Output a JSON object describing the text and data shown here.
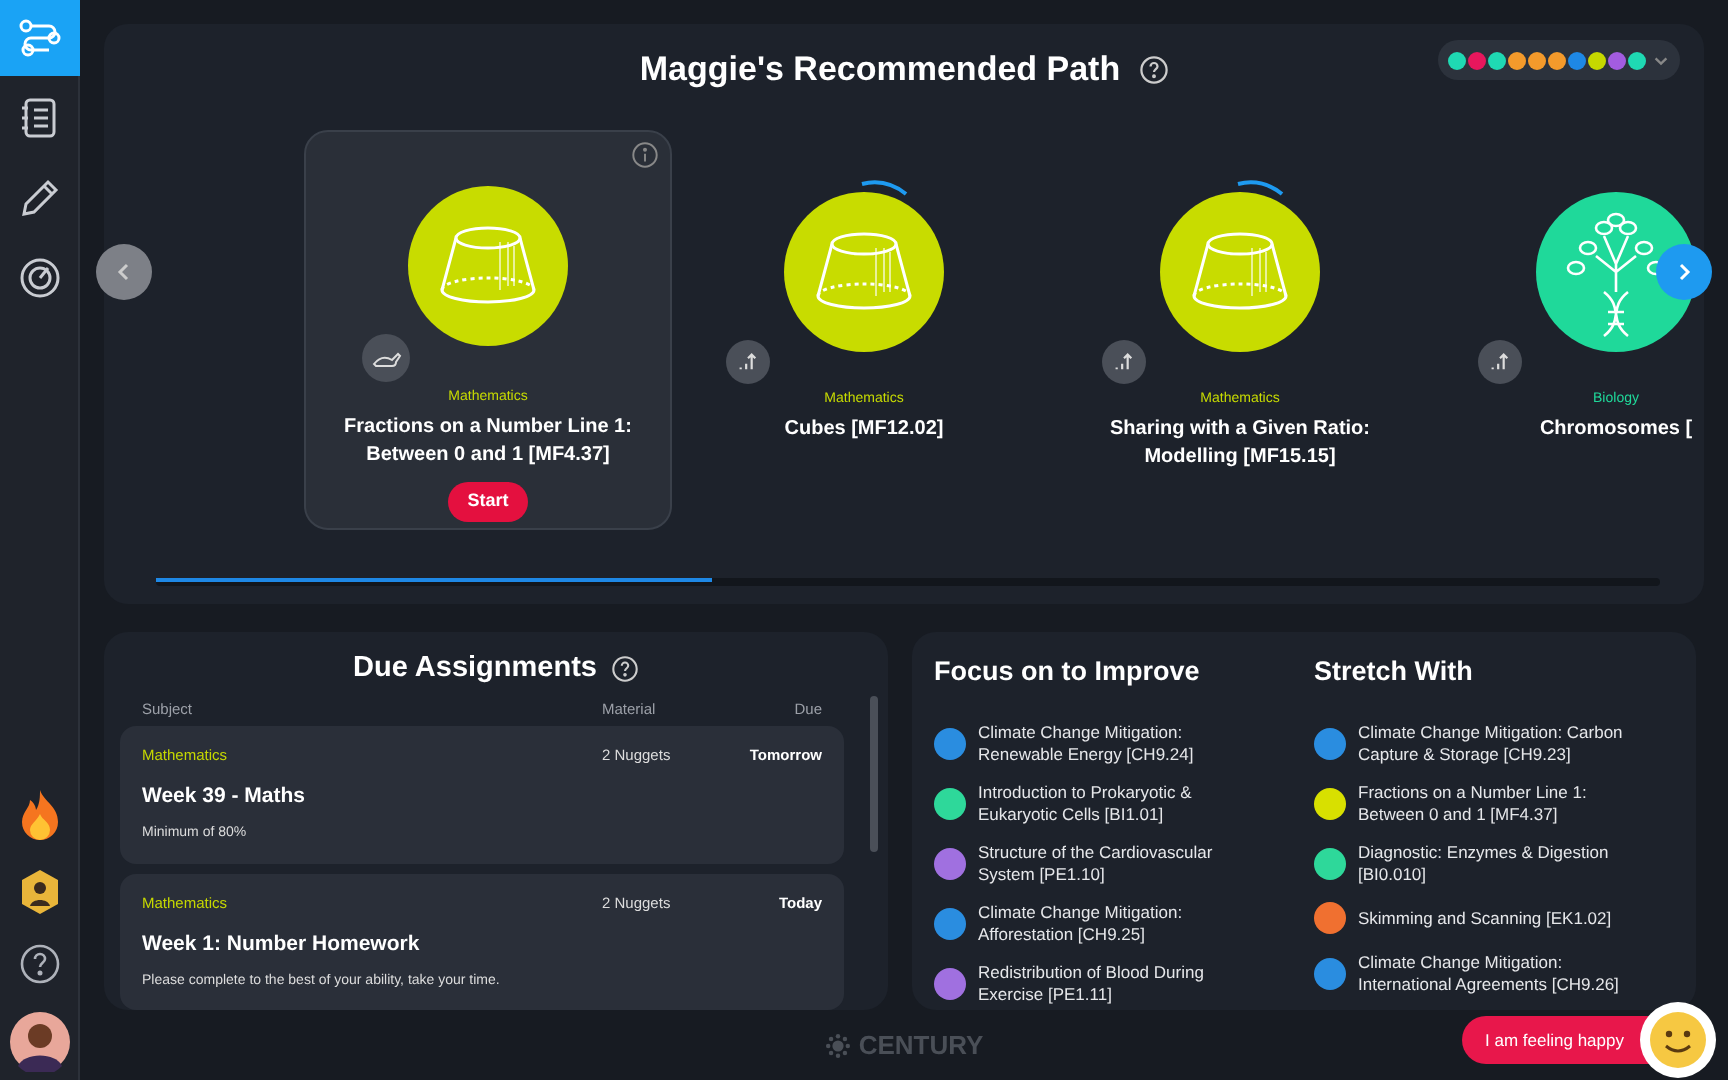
{
  "sidebar": {
    "items": [
      {
        "kind": "path",
        "selected": true
      },
      {
        "kind": "notebook",
        "selected": false
      },
      {
        "kind": "pencil",
        "selected": false
      },
      {
        "kind": "gauge",
        "selected": false
      }
    ]
  },
  "path": {
    "title": "Maggie's Recommended Path",
    "filters": [
      {
        "color": "#1fd9b3"
      },
      {
        "color": "#e8175d"
      },
      {
        "color": "#1fd9b3"
      },
      {
        "color": "#f49a2b"
      },
      {
        "color": "#f49a2b"
      },
      {
        "color": "#f49a2b"
      },
      {
        "color": "#1e88e5"
      },
      {
        "color": "#c6d800"
      },
      {
        "color": "#a35ce0"
      },
      {
        "color": "#1fd9b3"
      }
    ],
    "nuggets": [
      {
        "kind": "frustum",
        "color": "#c8dc00",
        "subject": "Mathematics",
        "title": "Fractions on a Number Line 1: Between 0 and 1 [MF4.37]",
        "selected": true,
        "in_progress": false,
        "action": "Start"
      },
      {
        "kind": "frustum",
        "color": "#c8dc00",
        "subject": "Mathematics",
        "title": "Cubes [MF12.02]",
        "selected": false,
        "in_progress": true
      },
      {
        "kind": "frustum",
        "color": "#c8dc00",
        "subject": "Mathematics",
        "title": "Sharing with a Given Ratio: Modelling [MF15.15]",
        "selected": false,
        "in_progress": true
      },
      {
        "kind": "tree",
        "color": "#1fd99a",
        "subject": "Biology",
        "title": "Chromosomes [",
        "selected": false,
        "in_progress": false
      }
    ]
  },
  "assignments": {
    "title": "Due Assignments",
    "columns": [
      "Subject",
      "Material",
      "Due"
    ],
    "rows": [
      {
        "subject": "Mathematics",
        "material": "2 Nuggets",
        "due": "Tomorrow",
        "title": "Week 39 - Maths",
        "note": "Minimum of 80%"
      },
      {
        "subject": "Mathematics",
        "material": "2 Nuggets",
        "due": "Today",
        "title": "Week 1: Number Homework",
        "note": "Please complete to the best of your ability, take your time."
      }
    ]
  },
  "focus": {
    "title": "Focus on to Improve",
    "items": [
      {
        "label": "Climate Change Mitigation: Renewable Energy [CH9.24]",
        "color": "#2a8de0"
      },
      {
        "label": "Introduction to Prokaryotic & Eukaryotic Cells [BI1.01]",
        "color": "#2ed89a"
      },
      {
        "label": "Structure of the Cardiovascular System [PE1.10]",
        "color": "#a070e0"
      },
      {
        "label": "Climate Change Mitigation: Afforestation [CH9.25]",
        "color": "#2a8de0"
      },
      {
        "label": "Redistribution of Blood During Exercise [PE1.11]",
        "color": "#a070e0"
      }
    ]
  },
  "stretch": {
    "title": "Stretch With",
    "items": [
      {
        "label": "Climate Change Mitigation: Carbon Capture & Storage [CH9.23]",
        "color": "#2a8de0"
      },
      {
        "label": "Fractions on a Number Line 1: Between 0 and 1 [MF4.37]",
        "color": "#d8e000"
      },
      {
        "label": "Diagnostic: Enzymes & Digestion [BI0.010]",
        "color": "#2ed89a"
      },
      {
        "label": "Skimming and Scanning [EK1.02]",
        "color": "#f07030"
      },
      {
        "label": "Climate Change Mitigation: International Agreements [CH9.26]",
        "color": "#2a8de0"
      }
    ]
  },
  "footer": {
    "logo": "CENTURY",
    "mood_button": "I am feeling happy"
  }
}
